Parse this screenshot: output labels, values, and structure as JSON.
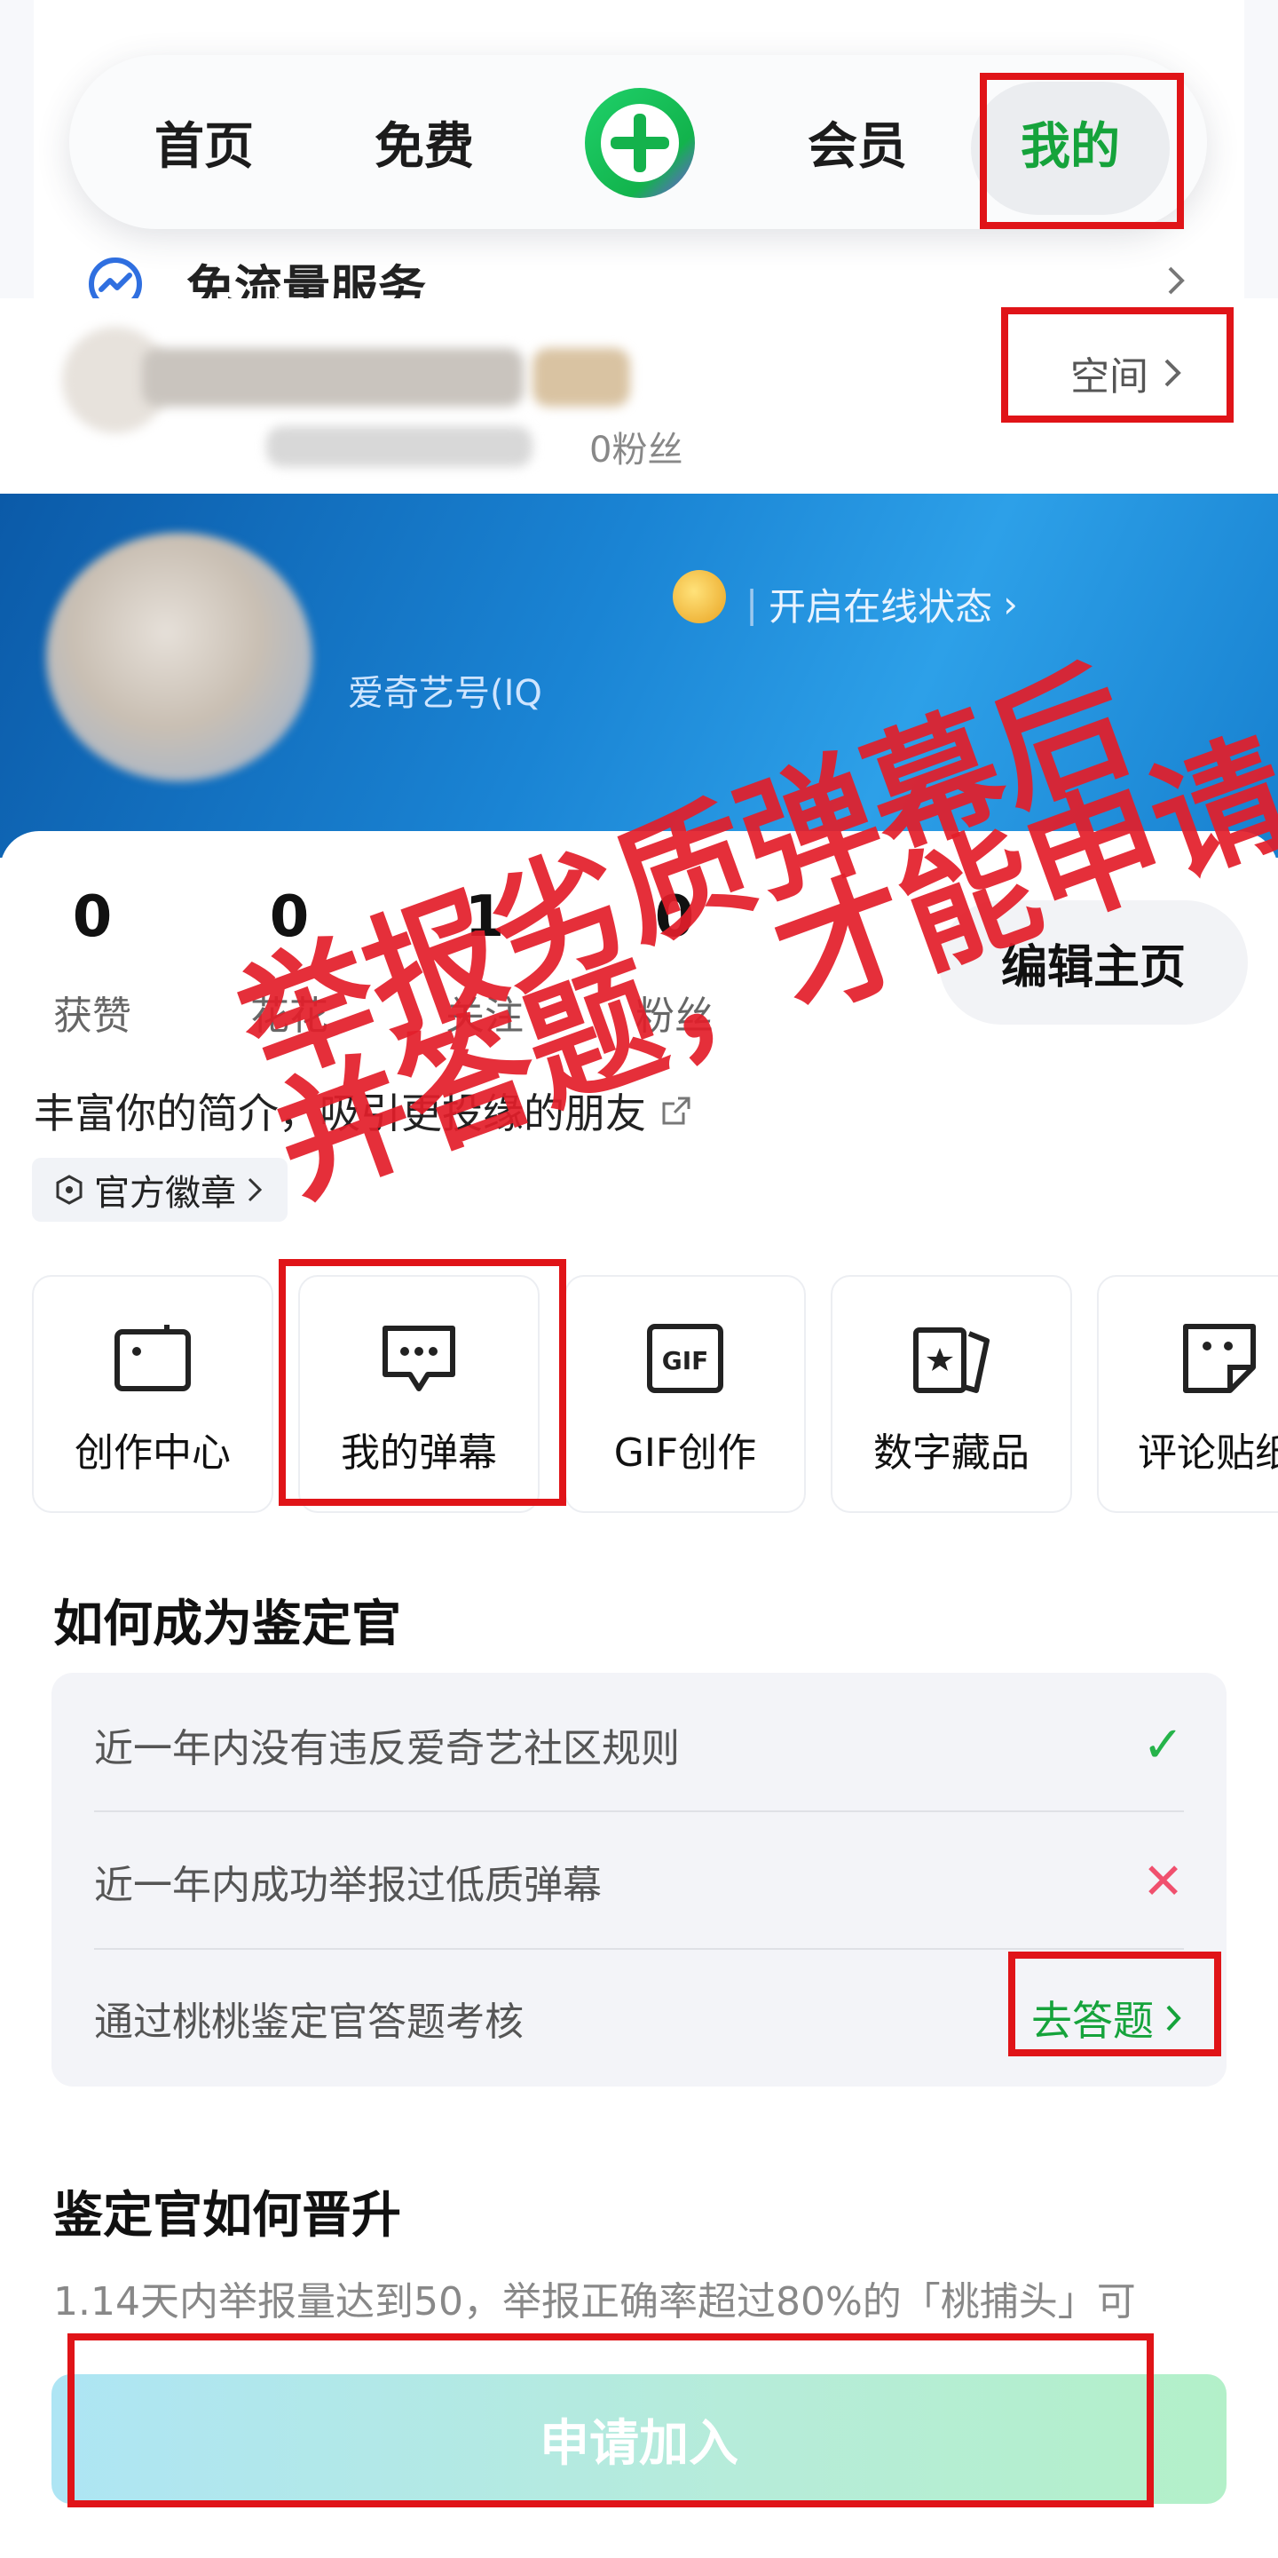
{
  "nav": {
    "home": "首页",
    "free": "免费",
    "vip": "会员",
    "mine": "我的"
  },
  "service_row": {
    "label": "免流量服务"
  },
  "profile": {
    "space_label": "空间",
    "fans_top": "0粉丝",
    "online_status": "开启在线状态",
    "iq_id": "爱奇艺号(IQ"
  },
  "stats": [
    {
      "value": "0",
      "label": "获赞"
    },
    {
      "value": "0",
      "label": "花花"
    },
    {
      "value": "1",
      "label": "关注"
    },
    {
      "value": "0",
      "label": "粉丝"
    }
  ],
  "edit_profile": "编辑主页",
  "bio_prompt": "丰富你的简介，吸引更投缘的朋友",
  "official_badge": "官方徽章",
  "tools": [
    {
      "label": "创作中心",
      "icon": "creator-camera-icon"
    },
    {
      "label": "我的弹幕",
      "icon": "danmaku-chat-icon"
    },
    {
      "label": "GIF创作",
      "icon": "gif-icon"
    },
    {
      "label": "数字藏品",
      "icon": "digital-collection-icon"
    },
    {
      "label": "评论贴纸",
      "icon": "comment-sticker-icon"
    }
  ],
  "appraiser": {
    "title": "如何成为鉴定官",
    "conditions": [
      {
        "text": "近一年内没有违反爱奇艺社区规则",
        "status": "✓"
      },
      {
        "text": "近一年内成功举报过低质弹幕",
        "status": "✕"
      },
      {
        "text": "通过桃桃鉴定官答题考核",
        "action": "去答题"
      }
    ]
  },
  "promotion": {
    "title": "鉴定官如何晋升",
    "desc": "1.14天内举报量达到50，举报正确率超过80%的「桃捕头」可"
  },
  "apply_button": "申请加入",
  "annotation": {
    "line1": "举报劣质弹幕后",
    "line2": "并答题，才能申请"
  },
  "colors": {
    "brand_green": "#15a33b",
    "annotation_red": "#e01418",
    "fail_red": "#f0506e",
    "ok_green": "#25b34a"
  }
}
